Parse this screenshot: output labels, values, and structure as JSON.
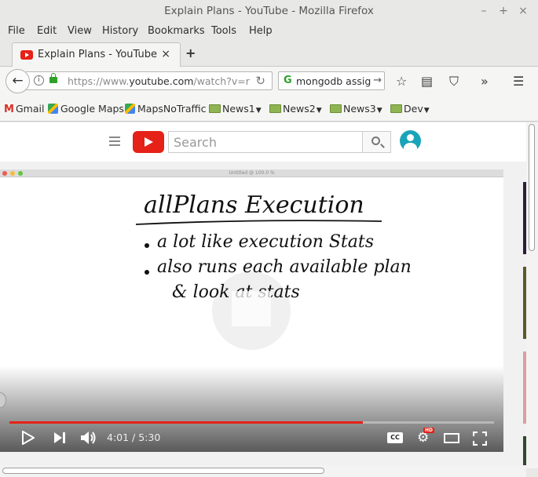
{
  "window": {
    "title": "Explain Plans - YouTube - Mozilla Firefox",
    "minimize": "–",
    "maximize": "+",
    "close": "×"
  },
  "menu": [
    {
      "label": "File",
      "key": "F"
    },
    {
      "label": "Edit",
      "key": "E"
    },
    {
      "label": "View",
      "key": "V"
    },
    {
      "label": "History",
      "key": "s"
    },
    {
      "label": "Bookmarks",
      "key": "B"
    },
    {
      "label": "Tools",
      "key": "T"
    },
    {
      "label": "Help",
      "key": "H"
    }
  ],
  "tab": {
    "label": "Explain Plans - YouTube",
    "close": "×",
    "new_tab": "+"
  },
  "navbar": {
    "back": "←",
    "url_prefix": "https://www.",
    "url_domain": "youtube.com",
    "url_rest": "/watch?v=r",
    "reload": "↻",
    "search_value": "mongodb assign",
    "search_go": "→",
    "icons": [
      "star-icon",
      "reader-list-icon",
      "pocket-icon",
      "overflow-icon",
      "hamburger-menu-icon"
    ]
  },
  "bookmarks": [
    {
      "label": "Gmail",
      "type": "gmail"
    },
    {
      "label": "Google Maps",
      "type": "maps"
    },
    {
      "label": "MapsNoTraffic",
      "type": "folder"
    },
    {
      "label": "News1",
      "type": "folder",
      "dropdown": true
    },
    {
      "label": "News2",
      "type": "folder",
      "dropdown": true
    },
    {
      "label": "News3",
      "type": "folder",
      "dropdown": true
    },
    {
      "label": "Dev",
      "type": "folder",
      "dropdown": true
    }
  ],
  "youtube": {
    "search_placeholder": "Search",
    "brand_color": "#e62117"
  },
  "video": {
    "inner_window_title": "Untitled @ 100.0 %",
    "heading": "allPlans Execution",
    "bullet1": "a lot like execution Stats",
    "bullet2_line1": "also runs each available plan",
    "bullet2_line2": "& look at stats",
    "current_time": "4:01",
    "duration": "5:30",
    "time_display": "4:01 / 5:30",
    "progress_fraction": 0.73,
    "hd_badge": "HD",
    "cc_label": "CC"
  }
}
